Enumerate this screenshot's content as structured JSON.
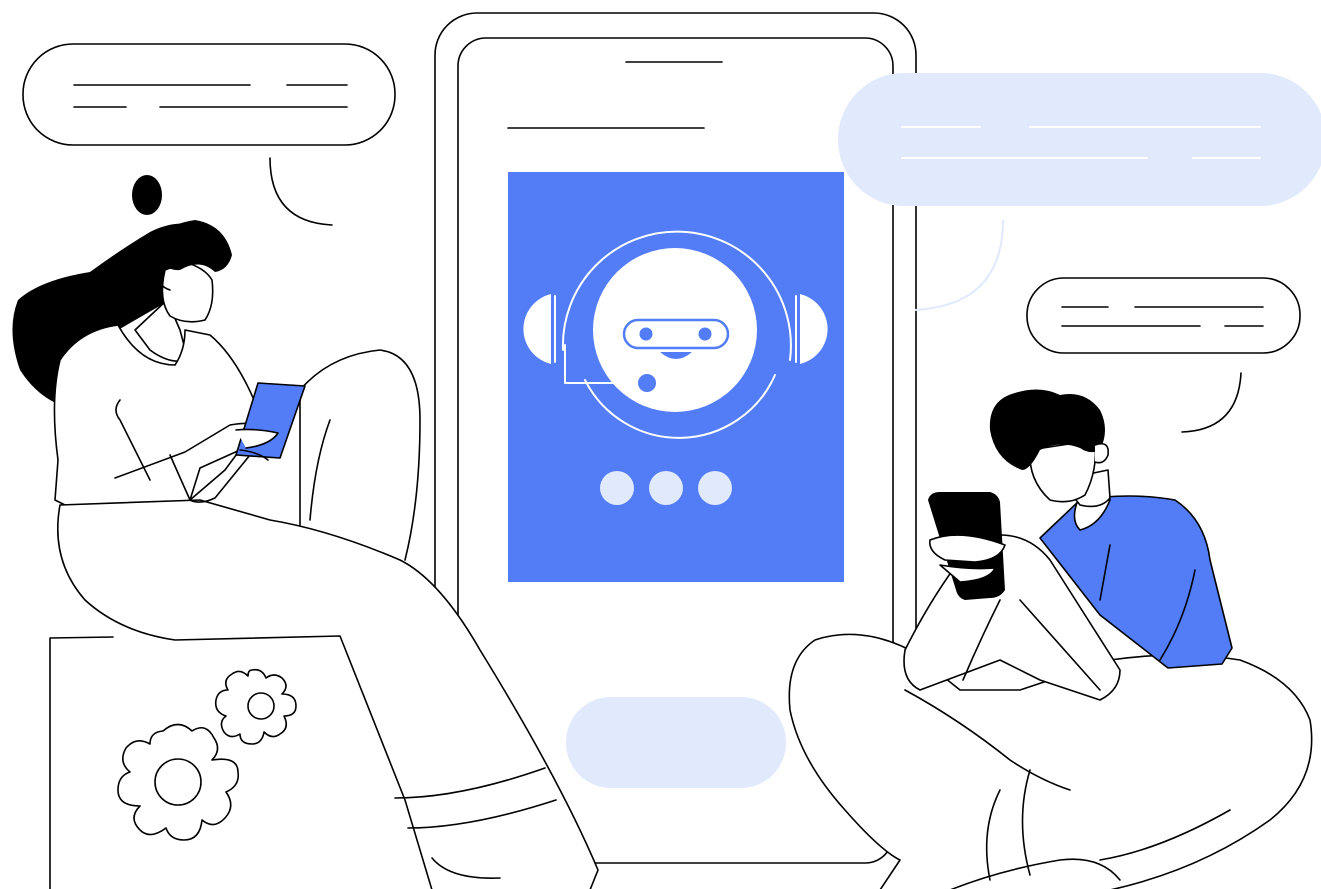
{
  "colors": {
    "accent": "#527df7",
    "light_accent": "#e1e9fd",
    "ink": "#000000",
    "background": "#ffffff"
  },
  "icons": {
    "assistant": "chatbot-headset-icon",
    "typing": "typing-indicator-dots-icon",
    "settings": "gears-icon"
  }
}
